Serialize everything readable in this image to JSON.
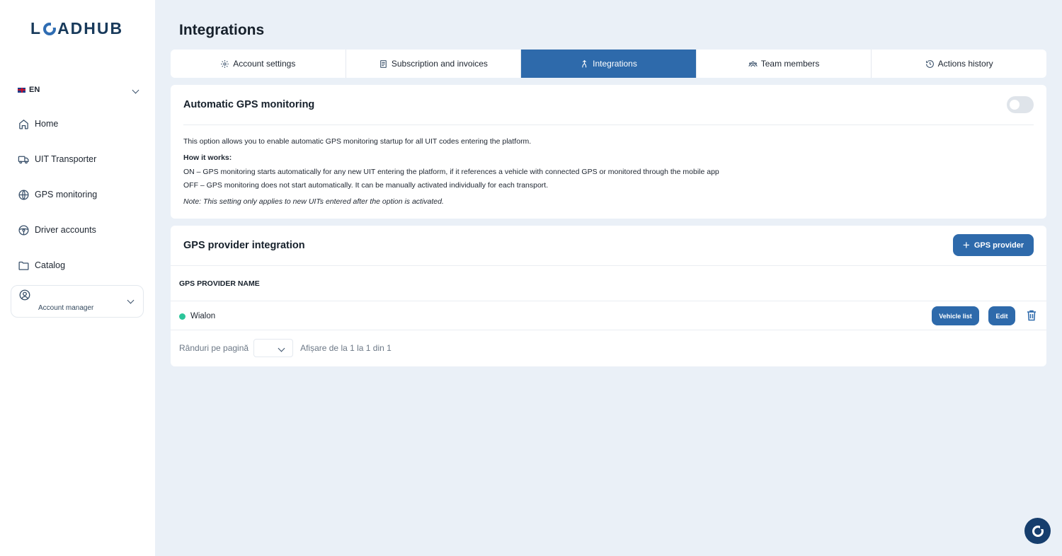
{
  "app": {
    "logo_pre": "L",
    "logo_post": "ADHUB"
  },
  "sidebar": {
    "language": "EN",
    "items": [
      {
        "label": "Home",
        "icon": "home-icon"
      },
      {
        "label": "UIT Transporter",
        "icon": "truck-icon"
      },
      {
        "label": "GPS monitoring",
        "icon": "globe-icon"
      },
      {
        "label": "Driver accounts",
        "icon": "steering-wheel-icon"
      },
      {
        "label": "Catalog",
        "icon": "folder-icon"
      }
    ],
    "account_label": "Account manager"
  },
  "page": {
    "title": "Integrations"
  },
  "tabs": [
    {
      "label": "Account settings",
      "icon": "gear-icon",
      "active": false
    },
    {
      "label": "Subscription and invoices",
      "icon": "invoice-icon",
      "active": false
    },
    {
      "label": "Integrations",
      "icon": "integration-icon",
      "active": true
    },
    {
      "label": "Team members",
      "icon": "team-icon",
      "active": false
    },
    {
      "label": "Actions history",
      "icon": "history-icon",
      "active": false
    }
  ],
  "gps_monitoring": {
    "title": "Automatic GPS monitoring",
    "enabled": false,
    "intro": "This option allows you to enable automatic GPS monitoring startup for all UIT codes entering the platform.",
    "how_title": "How it works:",
    "on_text": "ON – GPS monitoring starts automatically for any new UIT entering the platform, if it references a vehicle with connected GPS or monitored through the mobile app",
    "off_text": "OFF – GPS monitoring does not start automatically. It can be manually activated individually for each transport.",
    "note": "Note: This setting only applies to new UITs entered after the option is activated."
  },
  "gps_providers": {
    "title": "GPS provider integration",
    "add_label": "GPS provider",
    "column_header": "GPS PROVIDER NAME",
    "rows": [
      {
        "name": "Wialon",
        "status_color": "#2cc59a",
        "vehicle_list_label": "Vehicle list",
        "edit_label": "Edit"
      }
    ],
    "pagination": {
      "rows_per_page_label": "Rânduri pe pagină",
      "display_label": "Afișare de la 1 la 1 din 1"
    }
  },
  "colors": {
    "primary": "#2e6aab",
    "background": "#eaf0f7",
    "status_active": "#2cc59a"
  }
}
